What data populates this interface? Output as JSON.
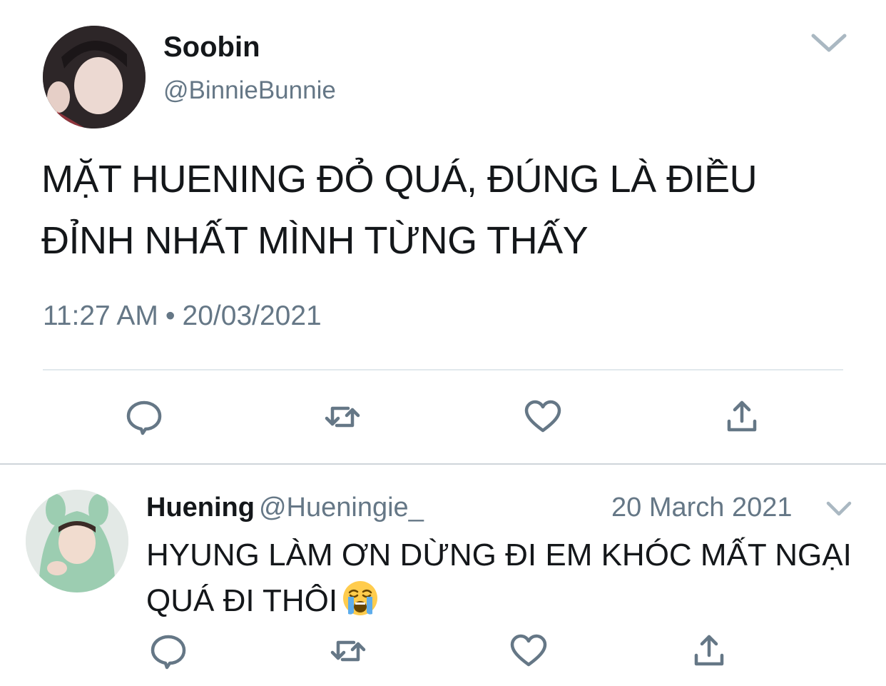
{
  "main_tweet": {
    "author_name": "Soobin",
    "author_handle": "@BinnieBunnie",
    "text": "MẶT HUENING ĐỎ QUÁ, ĐÚNG LÀ ĐIỀU ĐỈNH NHẤT MÌNH TỪNG THẤY",
    "time": "11:27 AM",
    "separator": "•",
    "date": "20/03/2021",
    "actions": [
      "reply-icon",
      "retweet-icon",
      "like-icon",
      "share-icon"
    ]
  },
  "reply_tweet": {
    "author_name": "Huening",
    "author_handle": "@Hueningie_",
    "date": "20 March 2021",
    "text": "HYUNG LÀM ƠN DỪNG ĐI EM KHÓC MẤT NGẠI QUÁ ĐI THÔI",
    "emoji": "loudly-crying-face",
    "actions": [
      "reply-icon",
      "retweet-icon",
      "like-icon",
      "share-icon"
    ]
  },
  "colors": {
    "text_primary": "#14171a",
    "text_secondary": "#657786",
    "icon_gray": "#657786",
    "divider": "#e1e8ed"
  }
}
